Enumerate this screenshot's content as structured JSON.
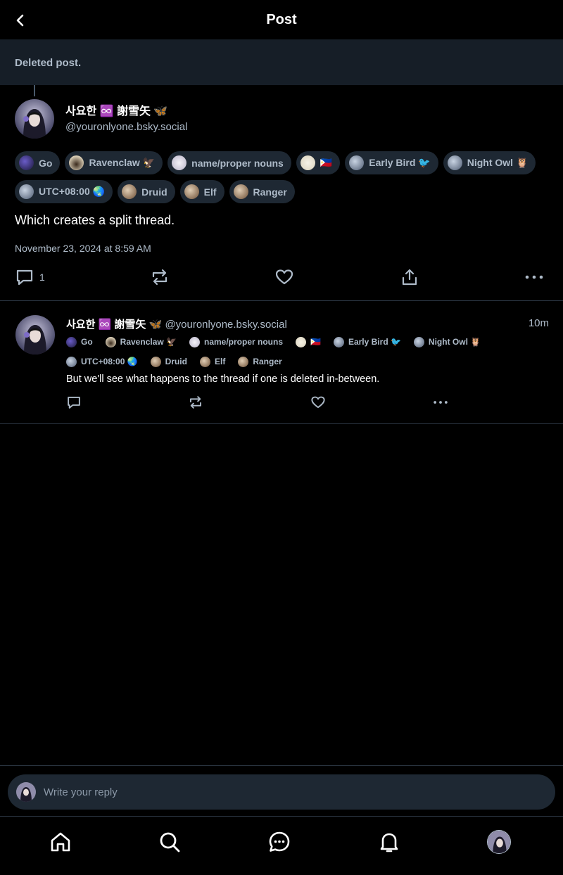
{
  "header": {
    "title": "Post"
  },
  "deleted_notice": "Deleted post.",
  "main_post": {
    "display_name": "사요한 ♾️ 謝雪矢 🦋",
    "handle": "@youronlyone.bsky.social",
    "labels": [
      {
        "text": "Go",
        "icon": "go-stone-icon",
        "color": "#2a2250"
      },
      {
        "text": "Ravenclaw 🦅",
        "icon": "ravenclaw-icon",
        "color": "#c9b89a"
      },
      {
        "text": "name/proper nouns",
        "icon": "name-icon",
        "color": "#d8d5e0"
      },
      {
        "text": "🇵🇭",
        "icon": "flower-icon",
        "color": "#f0ece0"
      },
      {
        "text": "Early Bird 🐦",
        "icon": "globe-icon",
        "color": "#8091a8"
      },
      {
        "text": "Night Owl 🦉",
        "icon": "globe-icon",
        "color": "#8091a8"
      },
      {
        "text": "UTC+08:00 🌏",
        "icon": "globe-icon",
        "color": "#8091a8"
      },
      {
        "text": "Druid",
        "icon": "druid-icon",
        "color": "#a8886a"
      },
      {
        "text": "Elf",
        "icon": "elf-icon",
        "color": "#a8886a"
      },
      {
        "text": "Ranger",
        "icon": "ranger-icon",
        "color": "#a8886a"
      }
    ],
    "text": "Which creates a split thread.",
    "date": "November 23, 2024 at 8:59 AM",
    "reply_count": "1"
  },
  "reply_post": {
    "display_name": "사요한 ♾️ 謝雪矢 🦋",
    "handle": "@youronlyone.bsky.social",
    "time": "10m",
    "labels": [
      {
        "text": "Go",
        "icon": "go-stone-icon",
        "color": "#2a2250"
      },
      {
        "text": "Ravenclaw 🦅",
        "icon": "ravenclaw-icon",
        "color": "#c9b89a"
      },
      {
        "text": "name/proper nouns",
        "icon": "name-icon",
        "color": "#d8d5e0"
      },
      {
        "text": "🇵🇭",
        "icon": "flower-icon",
        "color": "#f0ece0"
      },
      {
        "text": "Early Bird 🐦",
        "icon": "globe-icon",
        "color": "#8091a8"
      },
      {
        "text": "Night Owl 🦉",
        "icon": "globe-icon",
        "color": "#8091a8"
      },
      {
        "text": "UTC+08:00 🌏",
        "icon": "globe-icon",
        "color": "#8091a8"
      },
      {
        "text": "Druid",
        "icon": "druid-icon",
        "color": "#a8886a"
      },
      {
        "text": "Elf",
        "icon": "elf-icon",
        "color": "#a8886a"
      },
      {
        "text": "Ranger",
        "icon": "ranger-icon",
        "color": "#a8886a"
      }
    ],
    "text": "But we'll see what happens to the thread if one is deleted in-between."
  },
  "composer": {
    "placeholder": "Write your reply"
  },
  "nav": [
    "home-icon",
    "search-icon",
    "chat-icon",
    "bell-icon",
    "profile-avatar"
  ],
  "colors": {
    "background": "#000000",
    "surface": "#1e2833",
    "muted_text": "#aebbc9",
    "divider": "#2b3642"
  }
}
